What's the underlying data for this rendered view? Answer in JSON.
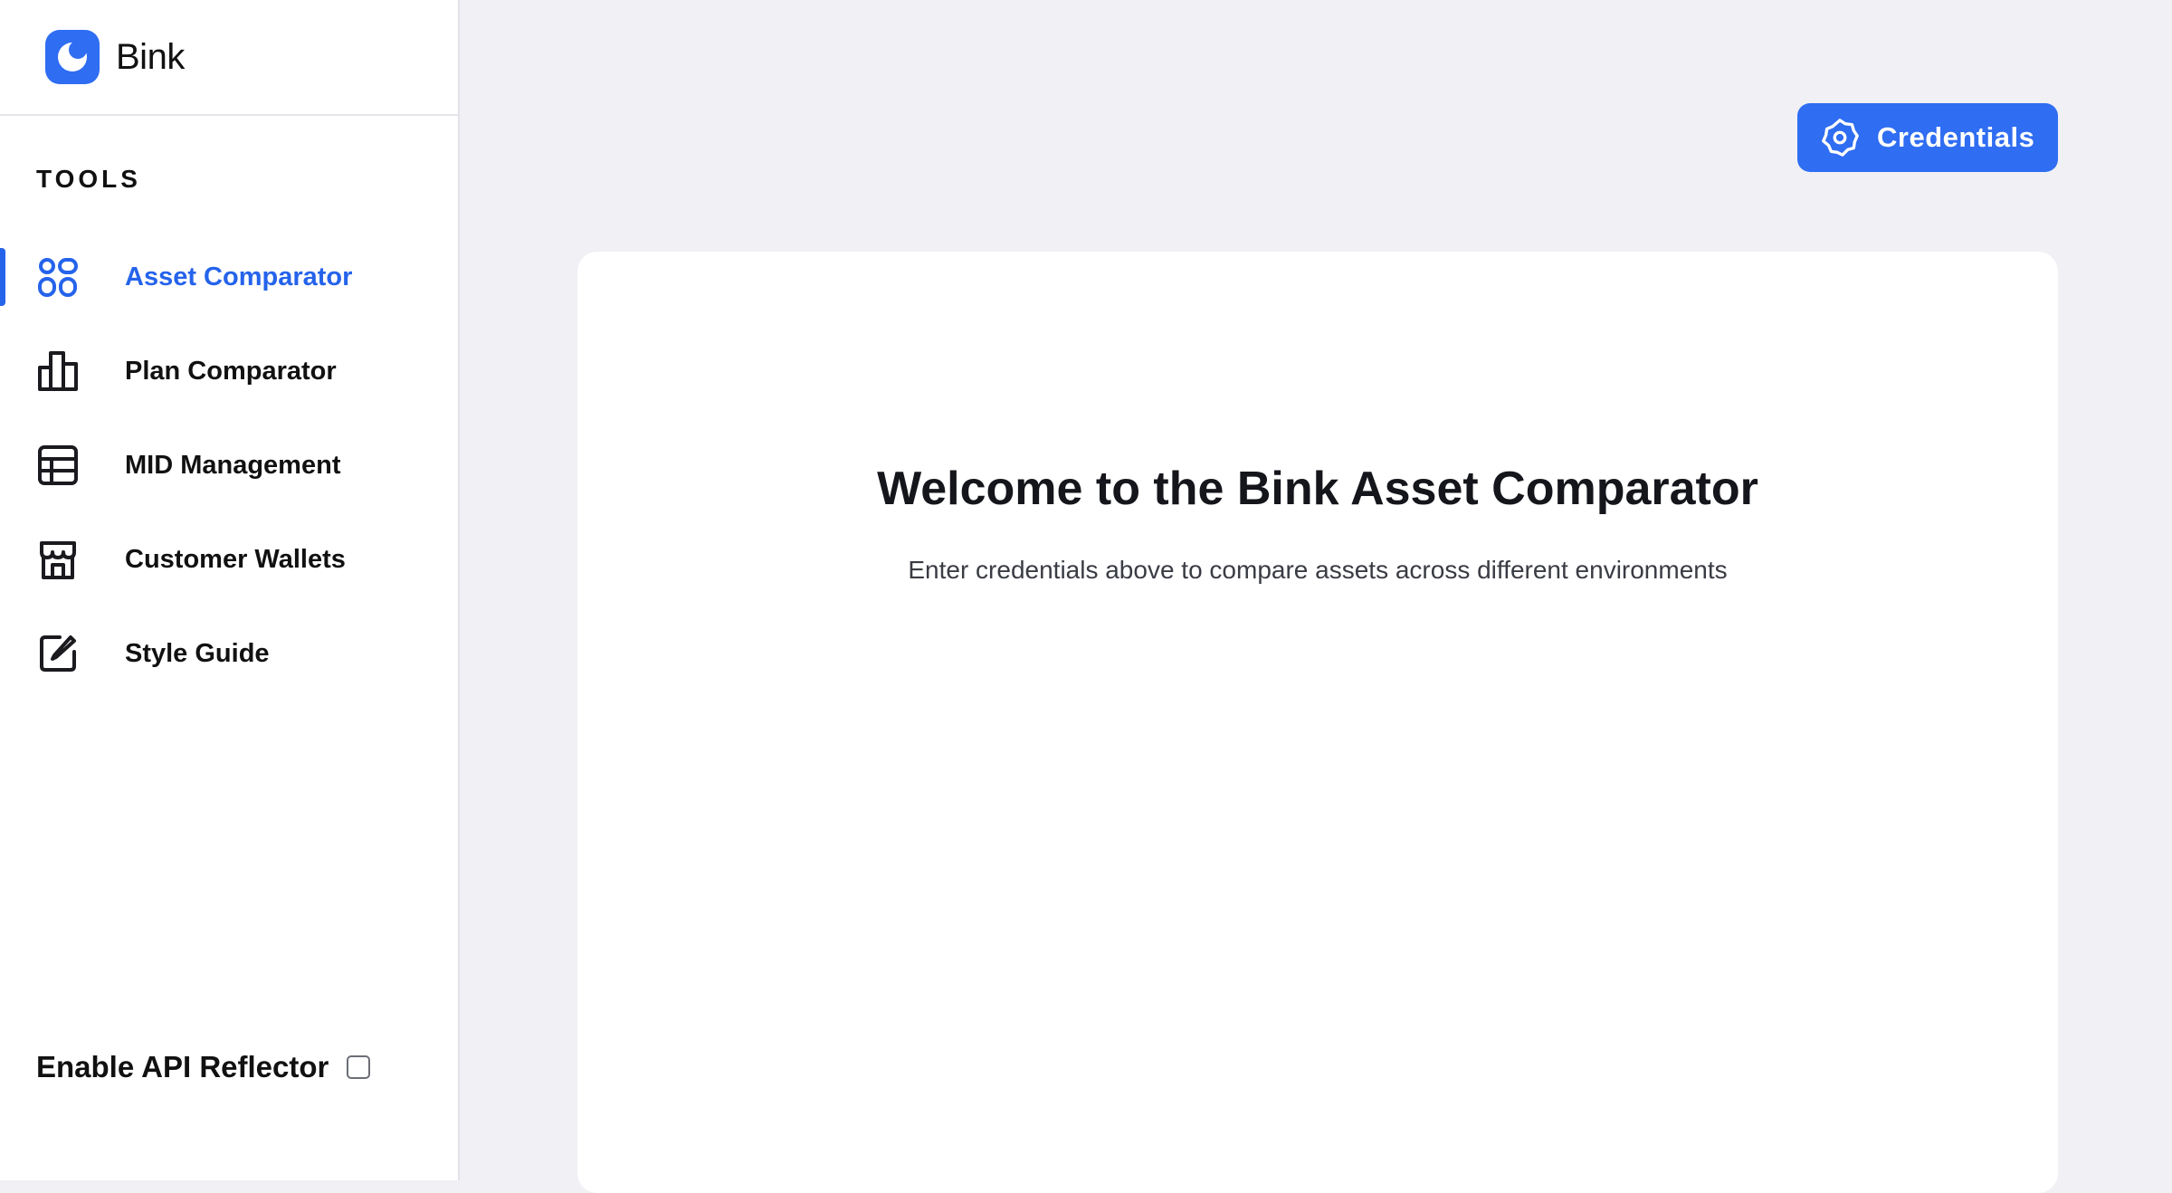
{
  "brand": {
    "name": "Bink"
  },
  "sidebar": {
    "section_title": "TOOLS",
    "items": [
      {
        "label": "Asset Comparator",
        "icon": "grid-icon",
        "active": true
      },
      {
        "label": "Plan Comparator",
        "icon": "bar-chart-icon",
        "active": false
      },
      {
        "label": "MID Management",
        "icon": "table-icon",
        "active": false
      },
      {
        "label": "Customer Wallets",
        "icon": "store-icon",
        "active": false
      },
      {
        "label": "Style Guide",
        "icon": "edit-icon",
        "active": false
      }
    ],
    "reflector": {
      "label": "Enable API Reflector",
      "checked": false
    }
  },
  "header": {
    "credentials_label": "Credentials"
  },
  "main": {
    "title": "Welcome to the Bink Asset Comparator",
    "subtitle": "Enter credentials above to compare assets across different environments"
  },
  "colors": {
    "accent": "#2563eb",
    "button": "#2f6df2",
    "background": "#f0f0f5",
    "surface": "#ffffff"
  }
}
